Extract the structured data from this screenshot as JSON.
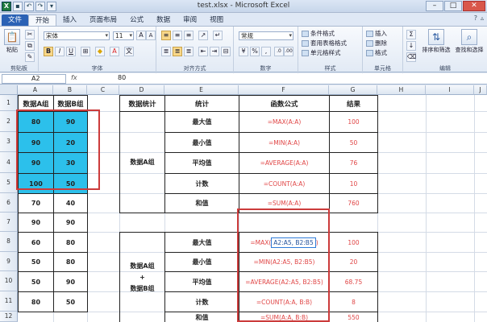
{
  "window": {
    "title": "test.xlsx - Microsoft Excel"
  },
  "qat": [
    "excel-logo",
    "save",
    "undo",
    "redo",
    "customize"
  ],
  "tabs": [
    "文件",
    "开始",
    "插入",
    "页面布局",
    "公式",
    "数据",
    "审阅",
    "视图"
  ],
  "ribbon": {
    "clipboard": {
      "paste": "粘贴",
      "label": "剪贴板"
    },
    "font": {
      "name": "宋体",
      "size": "11",
      "label": "字体",
      "bold": "B",
      "italic": "I",
      "underline": "U"
    },
    "alignment": {
      "label": "对齐方式"
    },
    "number": {
      "format": "常规",
      "percent": "%",
      "comma": ",",
      "label": "数字"
    },
    "styles": {
      "conditional": "条件格式",
      "table": "套用表格格式",
      "cell": "单元格样式",
      "label": "样式"
    },
    "cells": {
      "insert": "插入",
      "delete": "删除",
      "format": "格式",
      "label": "单元格"
    },
    "editing": {
      "sort": "排序和筛选",
      "find": "查找和选择",
      "label": "编辑"
    }
  },
  "formula_bar": {
    "name_box": "A2",
    "fx": "fx",
    "value": "80"
  },
  "columns": [
    "A",
    "B",
    "C",
    "D",
    "E",
    "F",
    "G",
    "H",
    "I",
    "J"
  ],
  "rows": [
    "1",
    "2",
    "3",
    "4",
    "5",
    "6",
    "7",
    "8",
    "9",
    "10",
    "11",
    "12"
  ],
  "data_table": {
    "headers": [
      "数据A组",
      "数据B组"
    ],
    "rows": [
      [
        "80",
        "90"
      ],
      [
        "90",
        "20"
      ],
      [
        "90",
        "30"
      ],
      [
        "100",
        "50"
      ],
      [
        "70",
        "40"
      ],
      [
        "90",
        "90"
      ],
      [
        "60",
        "80"
      ],
      [
        "50",
        "80"
      ],
      [
        "50",
        "90"
      ],
      [
        "80",
        "50"
      ]
    ]
  },
  "stats_table": {
    "headers": [
      "数据统计",
      "统计",
      "函数公式",
      "结果"
    ],
    "group1": "数据A组",
    "group2": [
      "数据A组",
      "+",
      "数据B组"
    ],
    "block1": [
      {
        "stat": "最大值",
        "formula": "=MAX(A:A)",
        "result": "100"
      },
      {
        "stat": "最小值",
        "formula": "=MIN(A:A)",
        "result": "50"
      },
      {
        "stat": "平均值",
        "formula": "=AVERAGE(A:A)",
        "result": "76"
      },
      {
        "stat": "计数",
        "formula": "=COUNT(A:A)",
        "result": "10"
      },
      {
        "stat": "和值",
        "formula": "=SUM(A:A)",
        "result": "760"
      }
    ],
    "block2": [
      {
        "stat": "最大值",
        "formula_pre": "=MAX(",
        "formula_ref": "A2:A5, B2:B5",
        "formula_post": ")",
        "result": "100"
      },
      {
        "stat": "最小值",
        "formula": "=MIN(A2:A5, B2:B5)",
        "result": "20"
      },
      {
        "stat": "平均值",
        "formula": "=AVERAGE(A2:A5, B2:B5)",
        "result": "68.75"
      },
      {
        "stat": "计数",
        "formula": "=COUNT(A:A, B:B)",
        "result": "8"
      },
      {
        "stat": "和值",
        "formula": "=SUM(A:A, B:B)",
        "result": "550"
      }
    ]
  },
  "colors": {
    "selection_fill": "#2cc0eb",
    "highlight_border": "#cc3b3b",
    "formula_text": "#e04646",
    "active_ref": "#2f7bd8"
  }
}
